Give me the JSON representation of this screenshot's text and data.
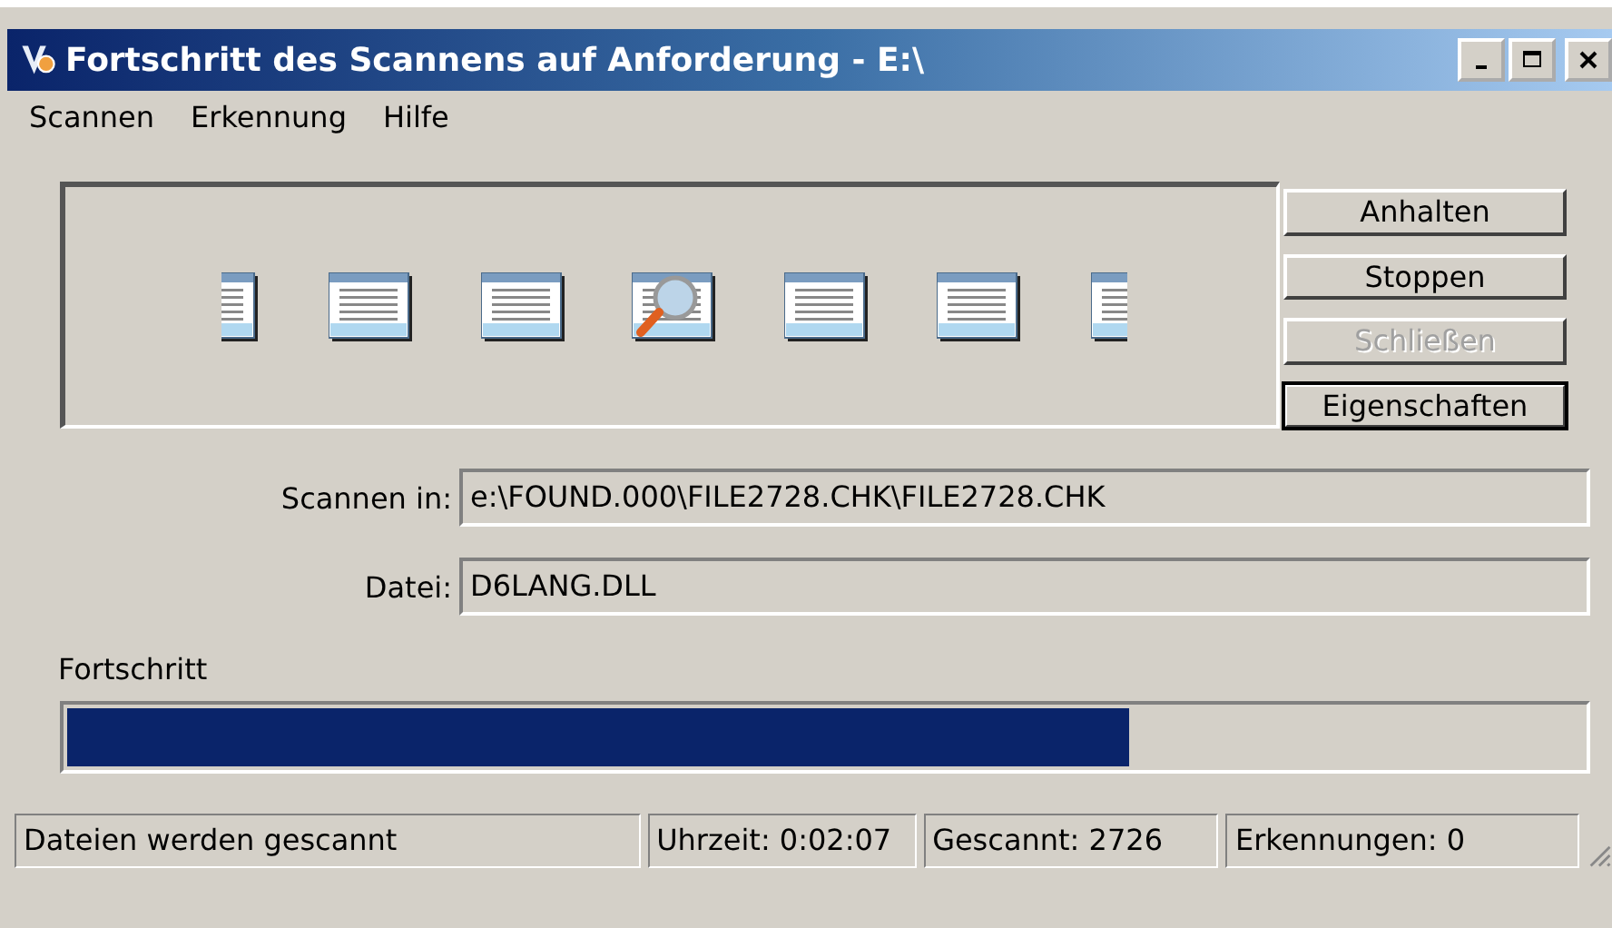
{
  "window": {
    "title": "Fortschritt des Scannens auf Anforderung - E:\\"
  },
  "menu": [
    "Scannen",
    "Erkennung",
    "Hilfe"
  ],
  "buttons": [
    {
      "label": "Anhalten",
      "disabled": false,
      "default": false
    },
    {
      "label": "Stoppen",
      "disabled": false,
      "default": false
    },
    {
      "label": "Schließen",
      "disabled": true,
      "default": false
    },
    {
      "label": "Eigenschaften",
      "disabled": false,
      "default": true
    }
  ],
  "fields": [
    {
      "label": "Scannen in:",
      "value": "e:\\FOUND.000\\FILE2728.CHK\\FILE2728.CHK"
    },
    {
      "label": "Datei:",
      "value": "D6LANG.DLL"
    }
  ],
  "progress": {
    "label": "Fortschritt",
    "level": 0.7
  },
  "status_bar": [
    "Dateien werden gescannt",
    "Uhrzeit: 0:02:07",
    "Gescannt: 2726",
    "Erkennungen: 0"
  ]
}
